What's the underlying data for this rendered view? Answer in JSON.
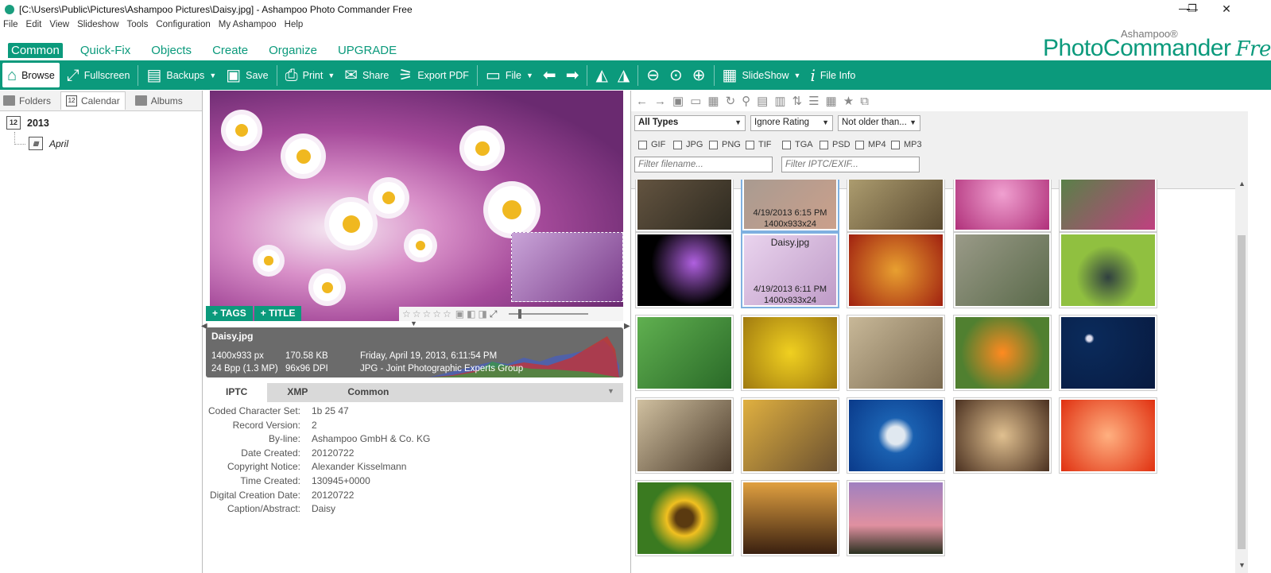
{
  "window": {
    "title": "[C:\\Users\\Public\\Pictures\\Ashampoo Pictures\\Daisy.jpg] - Ashampoo Photo Commander Free",
    "controls": [
      "—",
      "❐",
      "✕"
    ]
  },
  "menu": [
    "File",
    "Edit",
    "View",
    "Slideshow",
    "Tools",
    "Configuration",
    "My Ashampoo",
    "Help"
  ],
  "brand": {
    "small": "Ashampoo®",
    "name": "PhotoCommander",
    "edition": "Free"
  },
  "ribbon_tabs": [
    "Common",
    "Quick-Fix",
    "Objects",
    "Create",
    "Organize",
    "UPGRADE"
  ],
  "toolbar": {
    "browse": "Browse",
    "fullscreen": "Fullscreen",
    "backups": "Backups",
    "save": "Save",
    "print": "Print",
    "share": "Share",
    "export_pdf": "Export PDF",
    "file": "File",
    "slideshow": "SlideShow",
    "file_info": "File Info"
  },
  "left": {
    "tabs": [
      "Folders",
      "Calendar",
      "Albums"
    ],
    "calendar_day": "12",
    "year": "2013",
    "month": "April"
  },
  "preview": {
    "tags_label": "+ TAGS",
    "title_label": "+ TITLE",
    "stars": "☆☆☆☆☆"
  },
  "info": {
    "filename": "Daisy.jpg",
    "dimensions": "1400x933 px",
    "bpp": "24 Bpp (1.3 MP)",
    "size": "170.58 KB",
    "dpi": "96x96 DPI",
    "date": "Friday, April 19, 2013, 6:11:54 PM",
    "format": "JPG - Joint Photographic Experts Group"
  },
  "meta": {
    "tabs": [
      "IPTC",
      "XMP",
      "Common"
    ],
    "rows": [
      {
        "key": "Coded Character Set:",
        "value": "1b 25 47"
      },
      {
        "key": "Record Version:",
        "value": "2"
      },
      {
        "key": "By-line:",
        "value": "Ashampoo GmbH & Co. KG"
      },
      {
        "key": "Date Created:",
        "value": "20120722"
      },
      {
        "key": "Copyright Notice:",
        "value": "Alexander Kisselmann"
      },
      {
        "key": "Time Created:",
        "value": "130945+0000"
      },
      {
        "key": "Digital Creation Date:",
        "value": "20120722"
      },
      {
        "key": "Caption/Abstract:",
        "value": "Daisy"
      }
    ]
  },
  "filters": {
    "type": "All Types",
    "rating": "Ignore Rating",
    "age": "Not older than...",
    "types": [
      "GIF",
      "JPG",
      "PNG",
      "TIF",
      "TGA",
      "PSD",
      "MP4",
      "MP3"
    ],
    "filename_placeholder": "Filter filename...",
    "iptc_placeholder": "Filter IPTC/EXIF..."
  },
  "thumbs": {
    "sel_top": {
      "date": "4/19/2013 6:15 PM",
      "dims": "1400x933x24"
    },
    "daisy": {
      "name": "Daisy.jpg",
      "date": "4/19/2013 6:11 PM",
      "dims": "1400x933x24"
    }
  }
}
